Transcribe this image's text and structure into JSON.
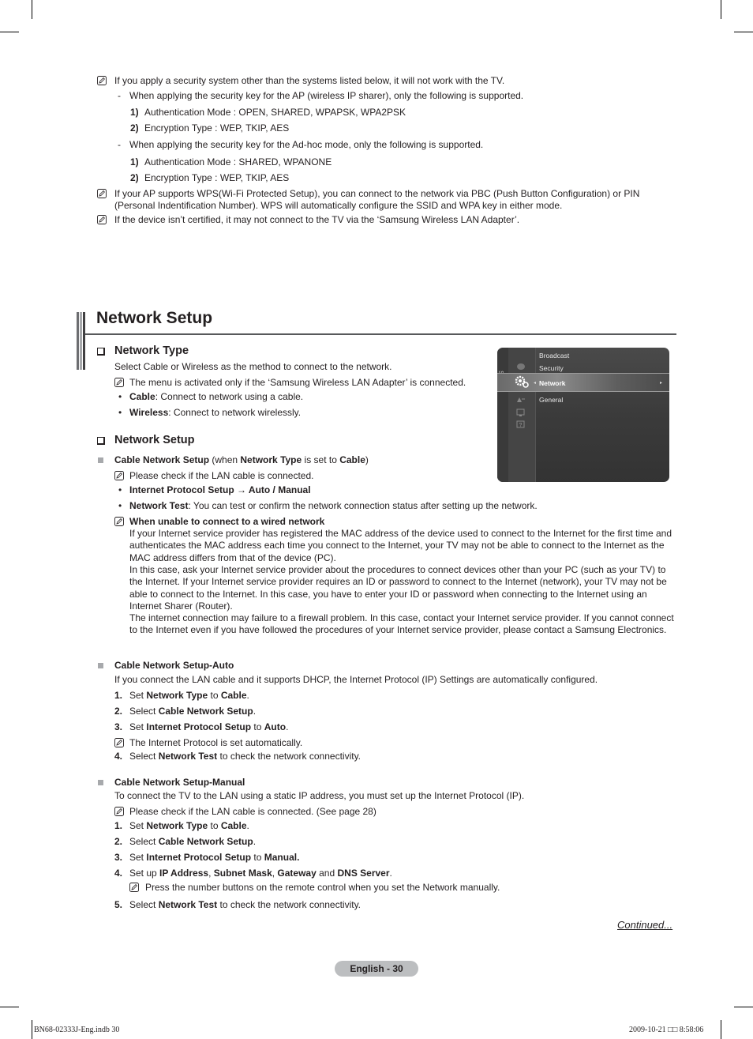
{
  "top_notes": {
    "note1": "If you apply a security system other than the systems listed below, it will not work with the TV.",
    "ap": {
      "dash": "-",
      "text": "When applying the security key for the AP (wireless IP sharer), only the following is supported.",
      "items": [
        {
          "num": "1)",
          "text": "Authentication Mode : OPEN, SHARED, WPAPSK, WPA2PSK"
        },
        {
          "num": "2)",
          "text": "Encryption Type : WEP, TKIP, AES"
        }
      ]
    },
    "adhoc": {
      "dash": "-",
      "text": "When applying the security key for the Ad-hoc mode, only the following is supported.",
      "items": [
        {
          "num": "1)",
          "text": "Authentication Mode : SHARED, WPANONE"
        },
        {
          "num": "2)",
          "text": "Encryption Type : WEP, TKIP, AES"
        }
      ]
    },
    "note2_line1": "If your AP supports WPS(Wi-Fi Protected Setup), you can connect to the network via PBC (Push Button Configuration) or PIN",
    "note2_line2": "(Personal Indentification Number). WPS will automatically configure the SSID and WPA key in either mode.",
    "note3": "If the device isn’t certified, it may not connect to the TV via the ‘Samsung Wireless LAN Adapter’."
  },
  "section": {
    "title": "Network Setup"
  },
  "network_type": {
    "heading": "Network Type",
    "intro": "Select Cable or Wireless as the method to connect to the network.",
    "note": "The menu is activated only if the ‘Samsung Wireless LAN Adapter’ is connected.",
    "bullets": [
      {
        "term": "Cable",
        "desc": ": Connect to network using a cable."
      },
      {
        "term": "Wireless",
        "desc": ": Connect to network wirelessly."
      }
    ]
  },
  "tv_menu": {
    "side_label": "Setup",
    "items": [
      "Broadcast",
      "Security",
      "Network",
      "General"
    ],
    "selected": "Network",
    "arrow_left": "◂",
    "arrow_right": "▸"
  },
  "network_setup": {
    "heading": "Network Setup",
    "cable": {
      "title_b1": "Cable Network Setup",
      "title_t1": " (when ",
      "title_b2": "Network Type",
      "title_t2": " is set to ",
      "title_b3": "Cable",
      "title_t3": ")",
      "note": "Please check if the LAN cable is connected.",
      "bullet1": "Internet Protocol Setup → Auto / Manual",
      "bullet2_term": "Network Test",
      "bullet2_desc": ": You can test or confirm the network connection status after setting up the network.",
      "unable_heading": "When unable to connect to a wired network",
      "unable_p1": "If your Internet service provider has registered the MAC address of the device used to connect to the Internet for the first time and authenticates the MAC address each time you connect to the Internet, your TV may not be able to connect to the Internet as the MAC address differs from that of the device (PC).",
      "unable_p2": "In this case, ask your Internet service provider about the procedures to connect devices other than your PC (such as your TV) to the Internet. If your Internet service provider requires an ID or password to connect to the Internet (network), your TV may not be able to connect to the Internet. In this case, you have to enter your ID or password when connecting to the Internet using an Internet Sharer (Router).",
      "unable_p3": "The internet connection may failure to a firewall problem. In this case, contact your Internet service provider. If you cannot connect to the Internet even if you have followed the procedures of your Internet service provider, please contact a Samsung Electronics."
    },
    "auto": {
      "title": "Cable Network Setup-Auto",
      "intro": "If you connect the LAN cable and it supports DHCP, the Internet Protocol (IP) Settings are automatically configured.",
      "steps": [
        {
          "num": "1.",
          "a": "Set ",
          "b": "Network Type",
          "c": " to ",
          "d": "Cable",
          "e": "."
        },
        {
          "num": "2.",
          "a": "Select ",
          "b": "Cable Network Setup",
          "c": ".",
          "d": "",
          "e": ""
        },
        {
          "num": "3.",
          "a": "Set ",
          "b": "Internet Protocol Setup",
          "c": " to ",
          "d": "Auto",
          "e": "."
        },
        {
          "num": "4.",
          "a": "Select ",
          "b": "Network Test",
          "c": " to check the network connectivity.",
          "d": "",
          "e": ""
        }
      ],
      "note": "The Internet Protocol is set automatically."
    },
    "manual": {
      "title": "Cable Network Setup-Manual",
      "intro": "To connect the TV to the LAN using a static IP address, you must set up the Internet Protocol (IP).",
      "note": "Please check if the LAN cable is connected. (See page 28)",
      "steps": [
        {
          "num": "1.",
          "a": "Set ",
          "b": "Network Type",
          "c": " to ",
          "d": "Cable",
          "e": "."
        },
        {
          "num": "2.",
          "a": "Select ",
          "b": "Cable Network Setup",
          "c": ".",
          "d": "",
          "e": ""
        },
        {
          "num": "3.",
          "a": "Set ",
          "b": "Internet Protocol Setup",
          "c": " to ",
          "d": "Manual.",
          "e": ""
        },
        {
          "num": "4.",
          "a": "Set up ",
          "b": "IP Address",
          "c": ", ",
          "d": "Subnet Mask",
          "e": ", ",
          "f": "Gateway",
          "g": " and ",
          "h": "DNS Server",
          "i": "."
        },
        {
          "num": "5.",
          "a": "Select ",
          "b": "Network Test",
          "c": " to check the network connectivity.",
          "d": "",
          "e": ""
        }
      ],
      "step4_note": "Press the number buttons on the remote control when you set the Network manually."
    }
  },
  "continued": "Continued...",
  "page_label": "English - 30",
  "footer": {
    "file": "BN68-02333J-Eng.indb   30",
    "datetime": "2009-10-21   □□ 8:58:06"
  }
}
